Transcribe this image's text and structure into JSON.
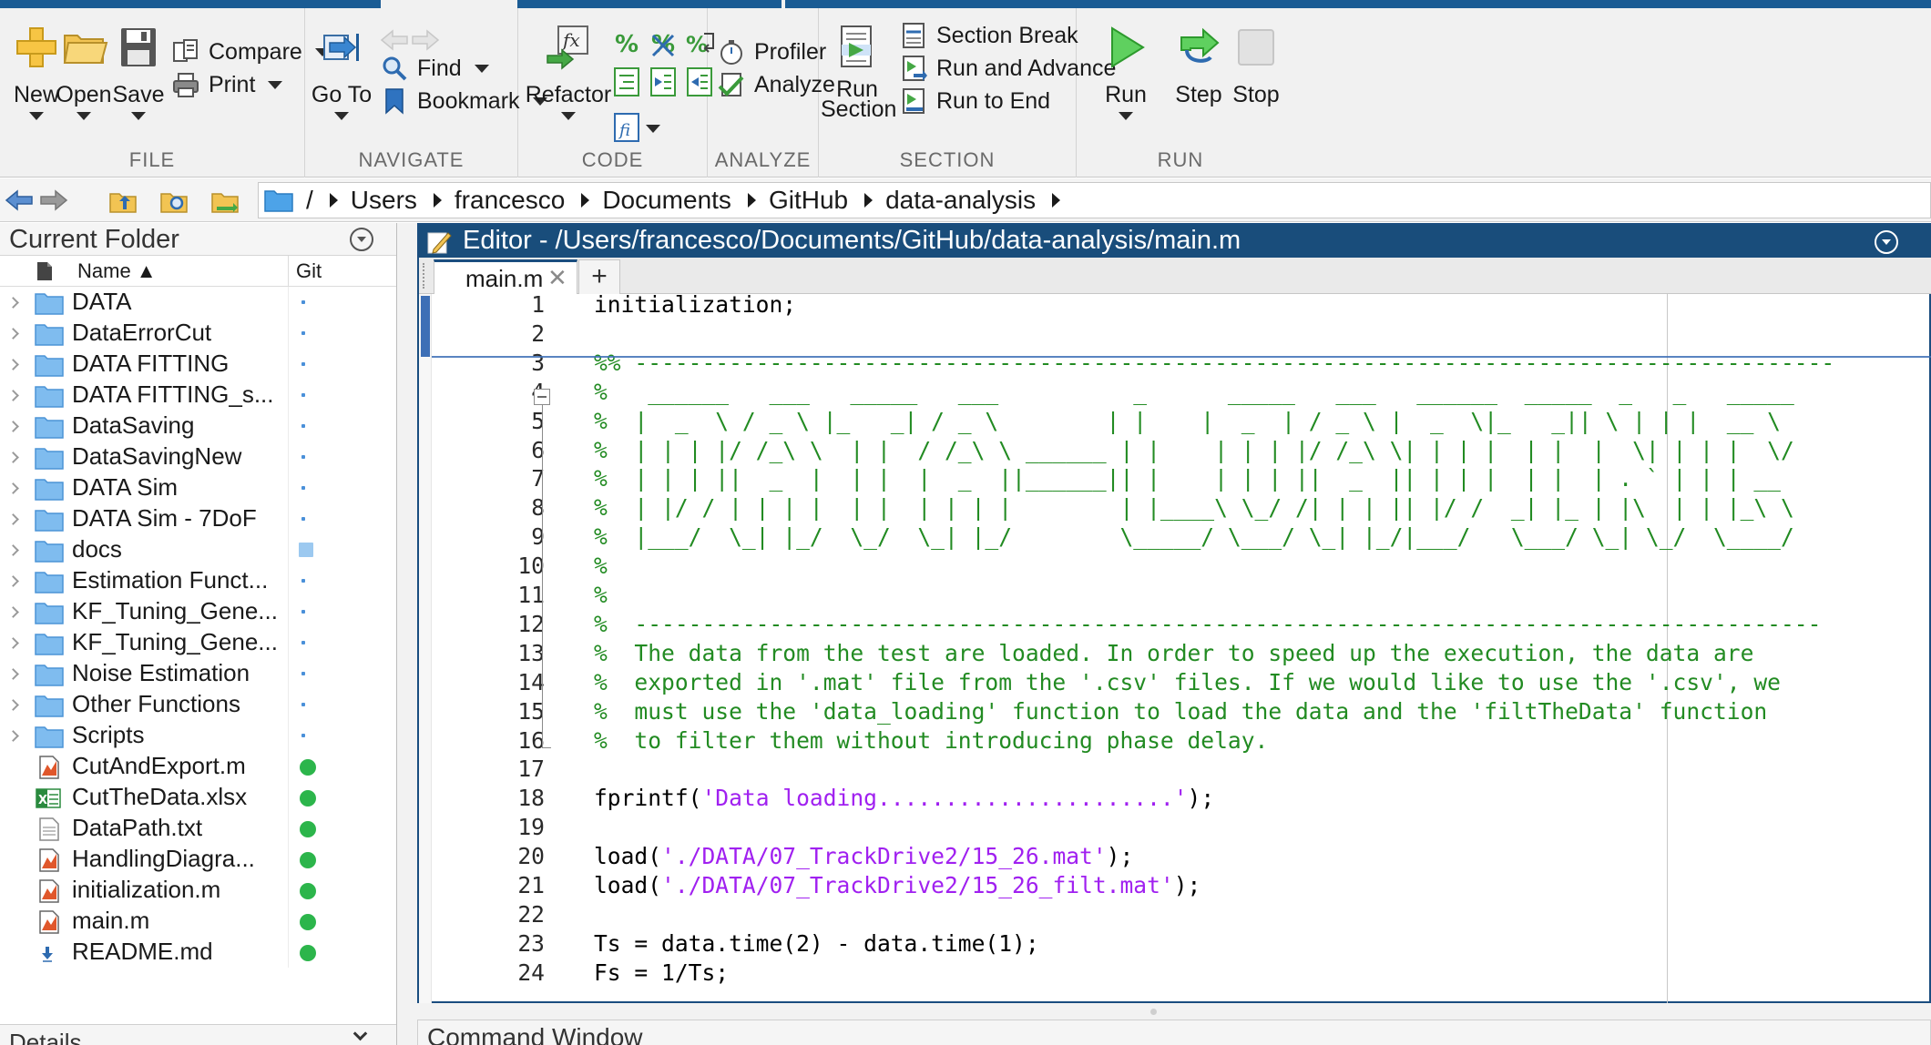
{
  "toolstrip": {
    "file": {
      "group_label": "FILE",
      "new_label": "New",
      "open_label": "Open",
      "save_label": "Save",
      "compare_label": "Compare",
      "print_label": "Print"
    },
    "navigate": {
      "group_label": "NAVIGATE",
      "goto_label": "Go To",
      "find_label": "Find",
      "bookmark_label": "Bookmark"
    },
    "code": {
      "group_label": "CODE",
      "refactor_label": "Refactor",
      "comment_icon_text": "%"
    },
    "analyze": {
      "group_label": "ANALYZE",
      "profiler_label": "Profiler",
      "analyze_label": "Analyze"
    },
    "section": {
      "group_label": "SECTION",
      "run_section_label_1": "Run",
      "run_section_label_2": "Section",
      "section_break_label": "Section Break",
      "run_and_advance_label": "Run and Advance",
      "run_to_end_label": "Run to End"
    },
    "run": {
      "group_label": "RUN",
      "run_label": "Run",
      "step_label": "Step",
      "stop_label": "Stop"
    }
  },
  "address_bar": {
    "path": [
      "/",
      "Users",
      "francesco",
      "Documents",
      "GitHub",
      "data-analysis"
    ]
  },
  "current_folder": {
    "title": "Current Folder",
    "col_name": "Name ▲",
    "col_git": "Git",
    "folders": [
      {
        "name": "DATA",
        "git": "dot"
      },
      {
        "name": "DataErrorCut",
        "git": "dot"
      },
      {
        "name": "DATA FITTING",
        "git": "dot"
      },
      {
        "name": "DATA FITTING_s...",
        "git": "dot"
      },
      {
        "name": "DataSaving",
        "git": "dot"
      },
      {
        "name": "DataSavingNew",
        "git": "dot"
      },
      {
        "name": "DATA Sim",
        "git": "dot"
      },
      {
        "name": "DATA Sim - 7DoF",
        "git": "dot"
      },
      {
        "name": "docs",
        "git": "square"
      },
      {
        "name": "Estimation Funct...",
        "git": "dot"
      },
      {
        "name": "KF_Tuning_Gene...",
        "git": "dot"
      },
      {
        "name": "KF_Tuning_Gene...",
        "git": "dot"
      },
      {
        "name": "Noise Estimation",
        "git": "dot"
      },
      {
        "name": "Other Functions",
        "git": "dot"
      },
      {
        "name": "Scripts",
        "git": "dot"
      }
    ],
    "files": [
      {
        "name": "CutAndExport.m",
        "type": "m",
        "git": "green"
      },
      {
        "name": "CutTheData.xlsx",
        "type": "xlsx",
        "git": "green"
      },
      {
        "name": "DataPath.txt",
        "type": "txt",
        "git": "green"
      },
      {
        "name": "HandlingDiagra...",
        "type": "m",
        "git": "green"
      },
      {
        "name": "initialization.m",
        "type": "m",
        "git": "green"
      },
      {
        "name": "main.m",
        "type": "m",
        "git": "green"
      },
      {
        "name": "README.md",
        "type": "md",
        "git": "green"
      }
    ],
    "details_label": "Details"
  },
  "editor": {
    "title": "Editor - /Users/francesco/Documents/GitHub/data-analysis/main.m",
    "tab_label": "main.m",
    "tab_close": "✕",
    "tab_add": "+",
    "lines": [
      {
        "n": "1",
        "kind": "code",
        "parts": [
          {
            "t": "initialization;"
          }
        ]
      },
      {
        "n": "2",
        "kind": "code",
        "parts": [
          {
            "t": ""
          }
        ]
      },
      {
        "n": "3",
        "kind": "comment",
        "parts": [
          {
            "t": "%% -----------------------------------------------------------------------------------------"
          }
        ]
      },
      {
        "n": "4",
        "kind": "comment",
        "parts": [
          {
            "t": "%   ______   ___   _____   ___          _      _____   ___   ______  _____  _   _   _____"
          }
        ]
      },
      {
        "n": "5",
        "kind": "comment",
        "parts": [
          {
            "t": "%  |  _  \\ / _ \\ |_   _| / _ \\        | |    |  _  | / _ \\ |  _  \\|_   _|| \\ | | |  __ \\"
          }
        ]
      },
      {
        "n": "6",
        "kind": "comment",
        "parts": [
          {
            "t": "%  | | | |/ /_\\ \\  | |  / /_\\ \\ ______ | |    | | | |/ /_\\ \\| | | |  | |  |  \\| | | |  \\/"
          }
        ]
      },
      {
        "n": "7",
        "kind": "comment",
        "parts": [
          {
            "t": "%  | | | ||  _  |  | |  |  _  ||______|| |    | | | ||  _  || | | |  | |  | . ` | | | __"
          }
        ]
      },
      {
        "n": "8",
        "kind": "comment",
        "parts": [
          {
            "t": "%  | |/ / | | | |  | |  | | | |        | |____\\ \\_/ /| | | || |/ /  _| |_ | |\\  | | |_\\ \\"
          }
        ]
      },
      {
        "n": "9",
        "kind": "comment",
        "parts": [
          {
            "t": "%  |___/  \\_| |_/  \\_/  \\_| |_/        \\_____/ \\___/ \\_| |_/|___/   \\___/ \\_| \\_/  \\____/"
          }
        ]
      },
      {
        "n": "10",
        "kind": "comment",
        "parts": [
          {
            "t": "%"
          }
        ]
      },
      {
        "n": "11",
        "kind": "comment",
        "parts": [
          {
            "t": "%"
          }
        ]
      },
      {
        "n": "12",
        "kind": "comment",
        "parts": [
          {
            "t": "%  ----------------------------------------------------------------------------------------"
          }
        ]
      },
      {
        "n": "13",
        "kind": "comment",
        "parts": [
          {
            "t": "%  The data from the test are loaded. In order to speed up the execution, the data are"
          }
        ]
      },
      {
        "n": "14",
        "kind": "comment",
        "parts": [
          {
            "t": "%  exported in '.mat' file from the '.csv' files. If we would like to use the '.csv', we"
          }
        ]
      },
      {
        "n": "15",
        "kind": "comment",
        "parts": [
          {
            "t": "%  must use the 'data_loading' function to load the data and the 'filtTheData' function"
          }
        ]
      },
      {
        "n": "16",
        "kind": "comment",
        "parts": [
          {
            "t": "%  to filter them without introducing phase delay."
          }
        ]
      },
      {
        "n": "17",
        "kind": "code",
        "parts": [
          {
            "t": ""
          }
        ]
      },
      {
        "n": "18",
        "kind": "code",
        "parts": [
          {
            "t": "fprintf("
          },
          {
            "t": "'Data loading......................'",
            "s": true
          },
          {
            "t": ");"
          }
        ]
      },
      {
        "n": "19",
        "kind": "code",
        "parts": [
          {
            "t": ""
          }
        ]
      },
      {
        "n": "20",
        "kind": "code",
        "parts": [
          {
            "t": "load("
          },
          {
            "t": "'./DATA/07_TrackDrive2/15_26.mat'",
            "s": true
          },
          {
            "t": ");"
          }
        ]
      },
      {
        "n": "21",
        "kind": "code",
        "parts": [
          {
            "t": "load("
          },
          {
            "t": "'./DATA/07_TrackDrive2/15_26_filt.mat'",
            "s": true
          },
          {
            "t": ");"
          }
        ]
      },
      {
        "n": "22",
        "kind": "code",
        "parts": [
          {
            "t": ""
          }
        ]
      },
      {
        "n": "23",
        "kind": "code",
        "parts": [
          {
            "t": "Ts = data.time(2) - data.time(1);"
          }
        ]
      },
      {
        "n": "24",
        "kind": "code",
        "parts": [
          {
            "t": "Fs = 1/Ts;"
          }
        ]
      }
    ]
  },
  "command_window": {
    "title": "Command Window"
  },
  "colors": {
    "editor_title_bg": "#194d7b",
    "comment": "#228b22",
    "string": "#a020f0",
    "git_clean": "#2cb54b",
    "toolstrip_bg": "#f1f1f1"
  }
}
